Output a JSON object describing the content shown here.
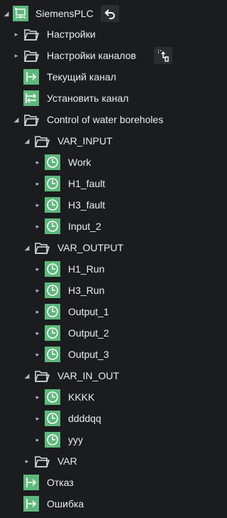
{
  "root": {
    "label": "SiemensPLC",
    "back_icon": "back-arrow-icon",
    "icon": "plc-network-icon"
  },
  "items": {
    "settings": {
      "label": "Настройки"
    },
    "channel_settings": {
      "label": "Настройки каналов",
      "action_icon": "channel-pick-icon"
    },
    "current_channel": {
      "label": "Текущий канал"
    },
    "set_channel": {
      "label": "Установить канал"
    },
    "program": {
      "label": "Control of water boreholes"
    },
    "var_input": {
      "label": "VAR_INPUT",
      "children": [
        "Work",
        "H1_fault",
        "H3_fault",
        "Input_2"
      ]
    },
    "var_output": {
      "label": "VAR_OUTPUT",
      "children": [
        "H1_Run",
        "H3_Run",
        "Output_1",
        "Output_2",
        "Output_3"
      ]
    },
    "var_in_out": {
      "label": "VAR_IN_OUT",
      "children": [
        "KKKK",
        "ddddqq",
        "yyy"
      ]
    },
    "var": {
      "label": "VAR"
    },
    "failure": {
      "label": "Отказ"
    },
    "error": {
      "label": "Ошибка"
    }
  },
  "colors": {
    "background": "#1b1c1e",
    "icon_green": "#5eb77b",
    "text": "#ececec",
    "arrow": "#b9b9b9",
    "button_bg": "#2c2d30"
  }
}
